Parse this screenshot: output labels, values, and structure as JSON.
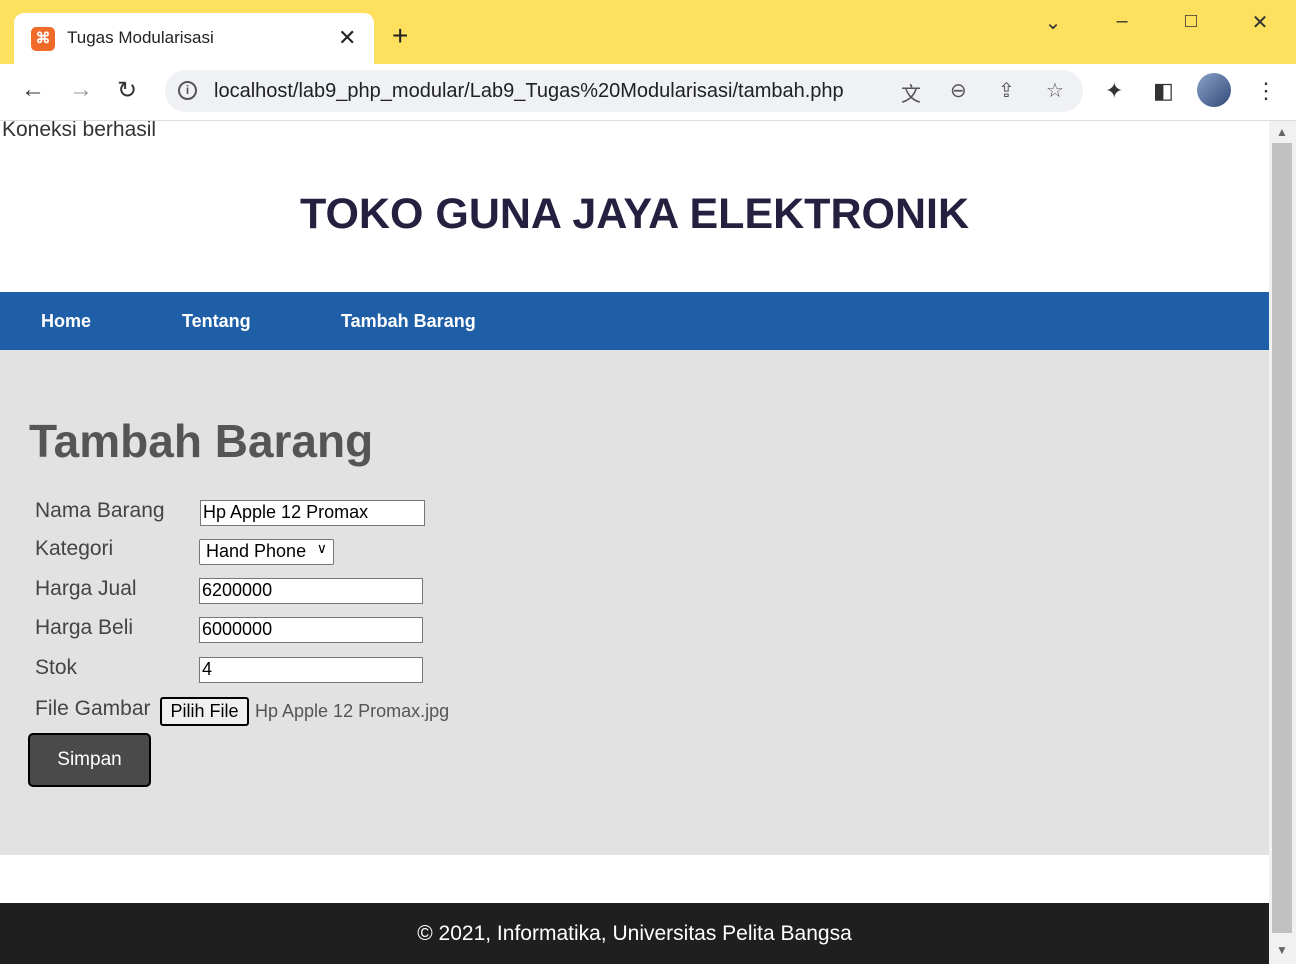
{
  "browser": {
    "tab_title": "Tugas Modularisasi",
    "tab_favicon": "xampp-icon",
    "new_tab": "+",
    "url": "localhost/lab9_php_modular/Lab9_Tugas%20Modularisasi/tambah.php"
  },
  "page": {
    "connection_status": "Koneksi berhasil",
    "site_title": "TOKO GUNA JAYA ELEKTRONIK",
    "nav": [
      "Home",
      "Tentang",
      "Tambah Barang"
    ],
    "form": {
      "title": "Tambah Barang",
      "labels": {
        "nama": "Nama Barang",
        "kategori": "Kategori",
        "harga_jual": "Harga Jual",
        "harga_beli": "Harga Beli",
        "stok": "Stok",
        "file": "File Gambar"
      },
      "values": {
        "nama": "Hp Apple 12 Promax",
        "kategori": "Hand Phone",
        "harga_jual": "6200000",
        "harga_beli": "6000000",
        "stok": "4",
        "file_name": "Hp Apple 12 Promax.jpg"
      },
      "file_button": "Pilih File",
      "submit": "Simpan"
    },
    "footer": "© 2021, Informatika, Universitas Pelita Bangsa"
  },
  "colors": {
    "titlebar": "#fde05e",
    "navbar": "#1f5fa8",
    "content_bg": "#e2e2e2",
    "footer_bg": "#1f1f1f"
  }
}
